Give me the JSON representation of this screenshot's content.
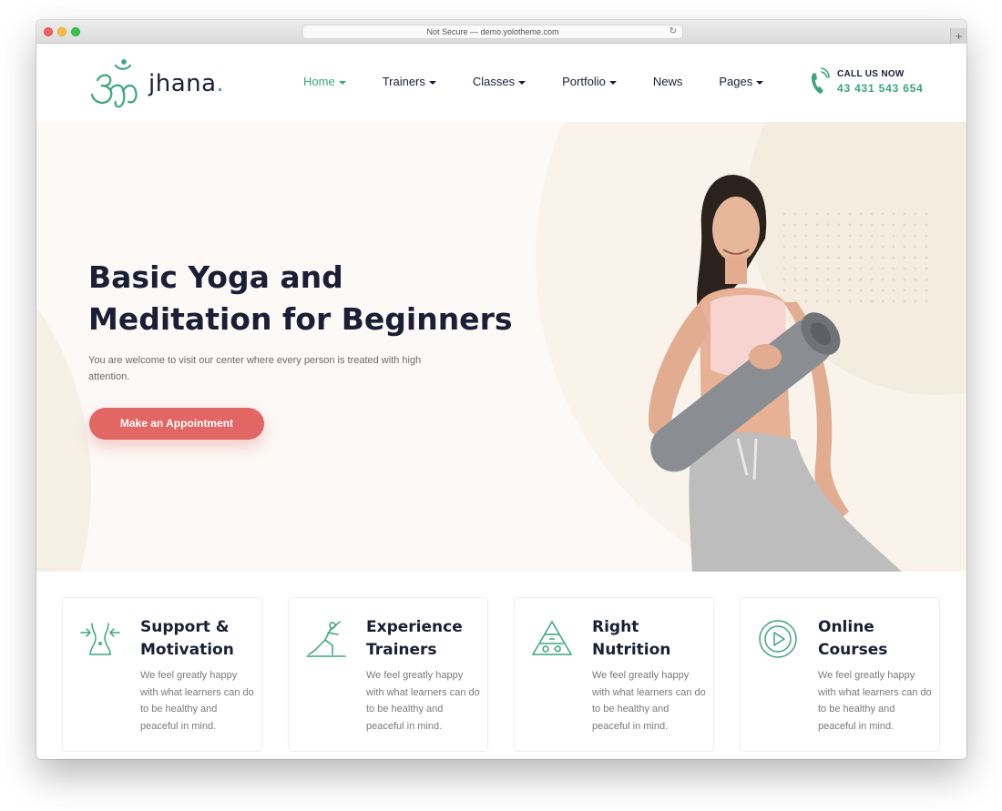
{
  "browser": {
    "url_text": "Not Secure — demo.yolotheme.com",
    "reload_glyph": "↻",
    "newtab_glyph": "+"
  },
  "header": {
    "logo_text": "jhana",
    "logo_dot": ".",
    "nav": [
      {
        "label": "Home",
        "has_caret": true,
        "active": true
      },
      {
        "label": "Trainers",
        "has_caret": true
      },
      {
        "label": "Classes",
        "has_caret": true
      },
      {
        "label": "Portfolio",
        "has_caret": true
      },
      {
        "label": "News",
        "has_caret": false
      },
      {
        "label": "Pages",
        "has_caret": true
      }
    ],
    "call_label": "CALL US NOW",
    "call_number": "43 431 543 654"
  },
  "hero": {
    "title_line1": "Basic Yoga and",
    "title_line2": "Meditation for Beginners",
    "subtitle": "You are welcome to visit our center where every person is treated with high attention.",
    "cta_label": "Make an Appointment"
  },
  "features": [
    {
      "icon": "waist-icon",
      "title_line1": "Support &",
      "title_line2": "Motivation",
      "desc": "We feel greatly happy with what learners can do to be healthy and peaceful in mind."
    },
    {
      "icon": "yoga-pose-icon",
      "title_line1": "Experience",
      "title_line2": "Trainers",
      "desc": "We feel greatly happy with what learners can do to be healthy and peaceful in mind."
    },
    {
      "icon": "nutrition-pyramid-icon",
      "title_line1": "Right",
      "title_line2": "Nutrition",
      "desc": "We feel greatly happy with what learners can do to be healthy and peaceful in mind."
    },
    {
      "icon": "play-circle-icon",
      "title_line1": "Online",
      "title_line2": "Courses",
      "desc": "We feel greatly happy with what learners can do to be healthy and peaceful in mind."
    }
  ],
  "colors": {
    "accent": "#3aa57e",
    "cta": "#e26663",
    "heading": "#1a1f36",
    "hero_bg": "#fcf9f6"
  }
}
